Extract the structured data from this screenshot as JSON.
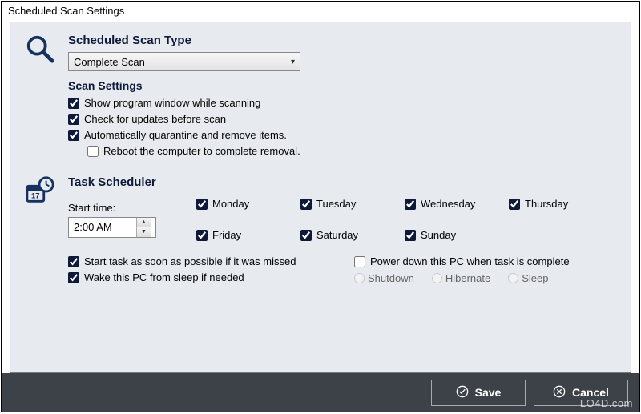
{
  "window": {
    "title": "Scheduled Scan Settings"
  },
  "scanType": {
    "heading": "Scheduled Scan Type",
    "selected": "Complete Scan"
  },
  "scanSettings": {
    "heading": "Scan Settings",
    "showWindow": {
      "label": "Show program window while scanning",
      "checked": true
    },
    "checkUpdates": {
      "label": "Check for updates before scan",
      "checked": true
    },
    "autoQuarantine": {
      "label": "Automatically quarantine and remove items.",
      "checked": true
    },
    "reboot": {
      "label": "Reboot the computer to complete removal.",
      "checked": false
    }
  },
  "scheduler": {
    "heading": "Task Scheduler",
    "startLabel": "Start time:",
    "startTime": "2:00 AM",
    "days": {
      "mon": {
        "label": "Monday",
        "checked": true
      },
      "tue": {
        "label": "Tuesday",
        "checked": true
      },
      "wed": {
        "label": "Wednesday",
        "checked": true
      },
      "thu": {
        "label": "Thursday",
        "checked": true
      },
      "fri": {
        "label": "Friday",
        "checked": true
      },
      "sat": {
        "label": "Saturday",
        "checked": true
      },
      "sun": {
        "label": "Sunday",
        "checked": true
      }
    },
    "startMissed": {
      "label": "Start task as soon as possible if it was missed",
      "checked": true
    },
    "wake": {
      "label": "Wake this PC from sleep if needed",
      "checked": true
    },
    "powerDown": {
      "label": "Power down this PC when task is complete",
      "checked": false
    },
    "radios": {
      "shutdown": "Shutdown",
      "hibernate": "Hibernate",
      "sleep": "Sleep"
    }
  },
  "footer": {
    "save": "Save",
    "cancel": "Cancel"
  },
  "watermark": "LO4D.com"
}
